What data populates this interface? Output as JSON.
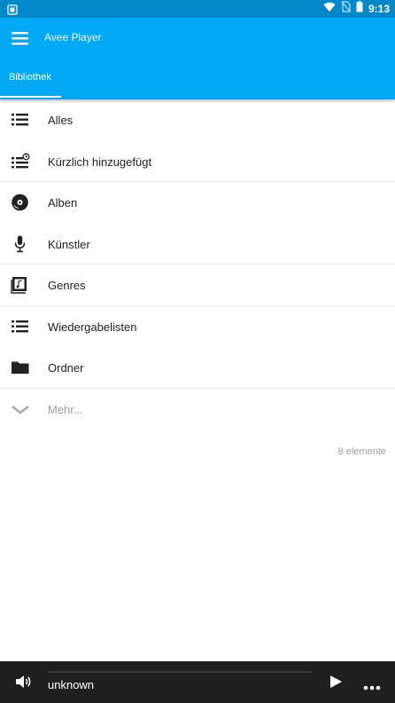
{
  "status_bar": {
    "time": "9:13",
    "icons": [
      "notification-icon",
      "wifi-icon",
      "no-sim-icon",
      "battery-icon"
    ]
  },
  "app_bar": {
    "title": "Avee Player",
    "menu_icon": "menu-icon"
  },
  "tabs": [
    {
      "label": "Bibliothek",
      "selected": true
    }
  ],
  "library": {
    "items": [
      {
        "label": "Alles",
        "icon": "list-icon"
      },
      {
        "label": "Kürzlich hinzugefügt",
        "icon": "recent-list-icon"
      },
      {
        "label": "Alben",
        "icon": "album-disc-icon"
      },
      {
        "label": "Künstler",
        "icon": "microphone-icon"
      },
      {
        "label": "Genres",
        "icon": "genre-icon"
      },
      {
        "label": "Wiedergabelisten",
        "icon": "playlist-icon"
      },
      {
        "label": "Ordner",
        "icon": "folder-icon"
      }
    ],
    "more": {
      "label": "Mehr...",
      "icon": "chevron-down-icon"
    },
    "count": "8 elemente"
  },
  "player": {
    "track_title": "unknown",
    "progress": 0,
    "icons": [
      "volume-icon",
      "play-icon",
      "more-icon"
    ]
  },
  "colors": {
    "status_bar": "#0288c8",
    "app_bar": "#03a9f4",
    "player_bar": "#1f1f1f"
  }
}
